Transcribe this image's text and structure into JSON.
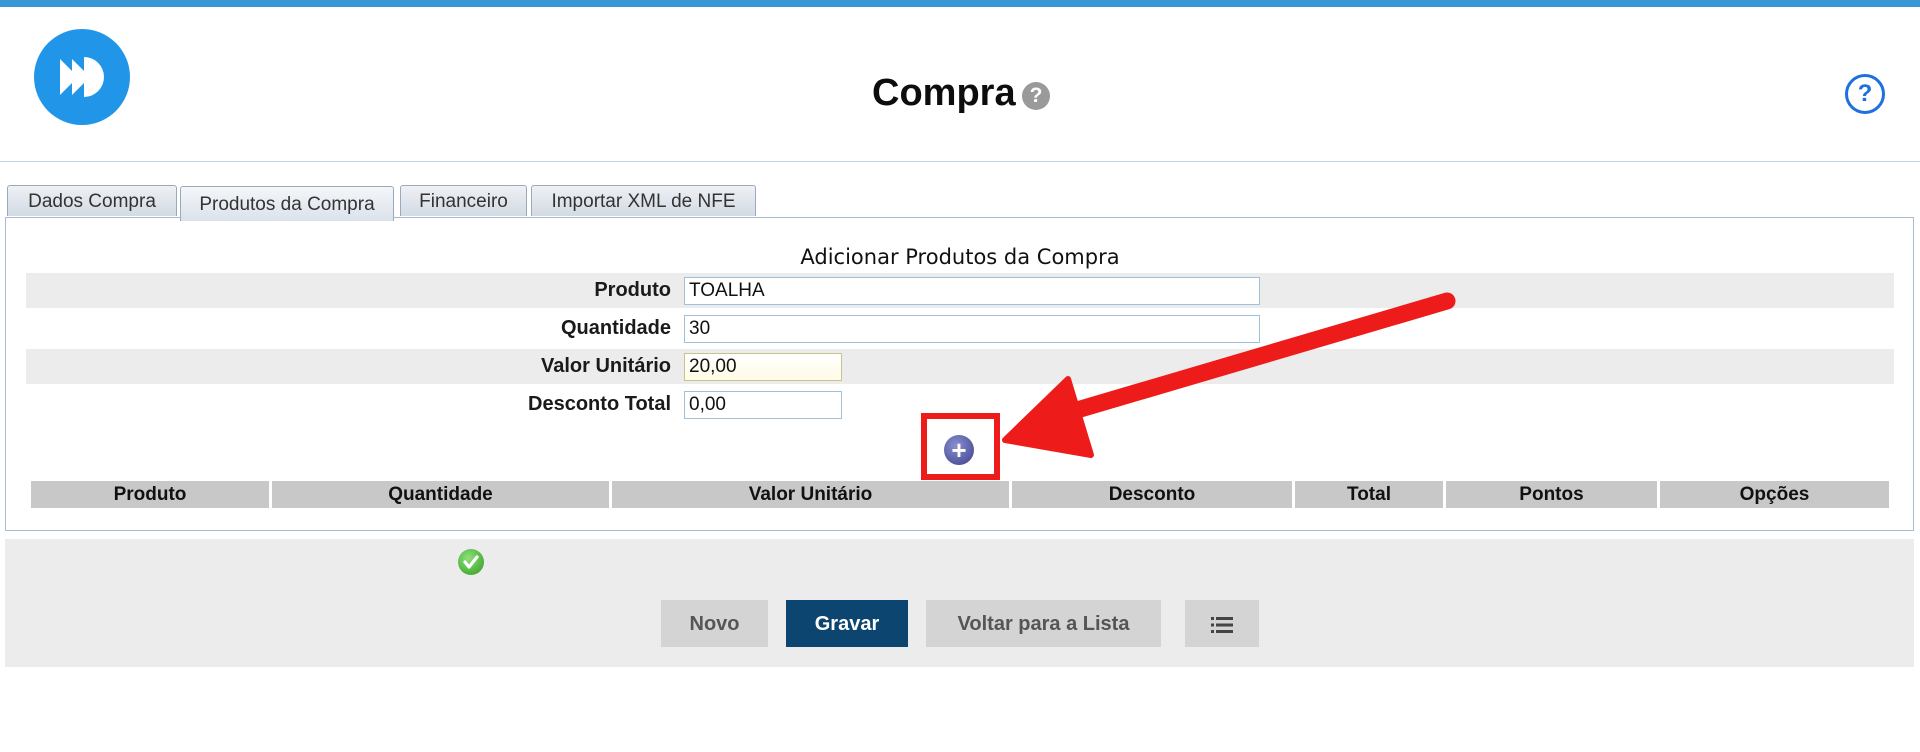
{
  "header": {
    "title": "Compra",
    "title_help_glyph": "?",
    "help_glyph": "?",
    "logo_icon": "fast-forward-icon"
  },
  "tabs": [
    {
      "label": "Dados Compra",
      "active": false
    },
    {
      "label": "Produtos da Compra",
      "active": true
    },
    {
      "label": "Financeiro",
      "active": false
    },
    {
      "label": "Importar XML de NFE",
      "active": false
    }
  ],
  "form": {
    "title": "Adicionar Produtos da Compra",
    "fields": {
      "produto": {
        "label": "Produto",
        "value": "TOALHA"
      },
      "quantidade": {
        "label": "Quantidade",
        "value": "30"
      },
      "valor_unitario": {
        "label": "Valor Unitário",
        "value": "20,00"
      },
      "desconto_total": {
        "label": "Desconto Total",
        "value": "0,00"
      }
    },
    "add_glyph": "+"
  },
  "table": {
    "columns": [
      "Produto",
      "Quantidade",
      "Valor Unitário",
      "Desconto",
      "Total",
      "Pontos",
      "Opções"
    ],
    "rows": []
  },
  "footer": {
    "buttons": {
      "novo": "Novo",
      "gravar": "Gravar",
      "voltar": "Voltar para a Lista"
    },
    "list_icon": "list-icon",
    "status_icon": "check-icon"
  },
  "colors": {
    "accent": "#2196e8",
    "primary_button": "#0c4670",
    "highlight": "#ee1b1b"
  }
}
